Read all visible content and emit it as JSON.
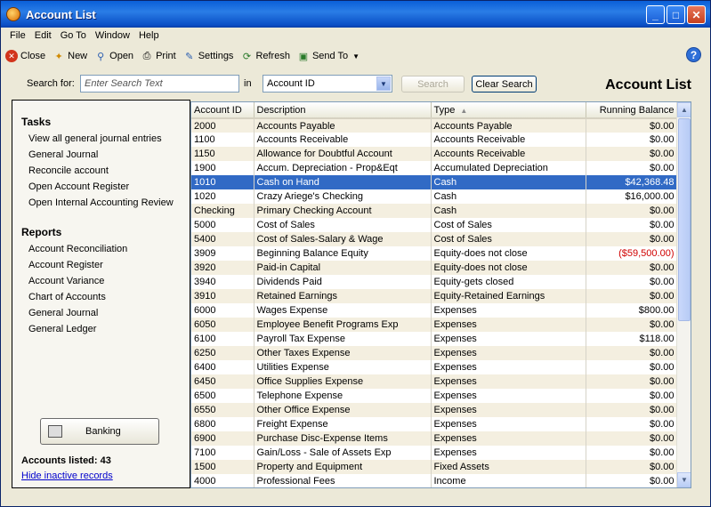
{
  "window": {
    "title": "Account List"
  },
  "menu": [
    "File",
    "Edit",
    "Go To",
    "Window",
    "Help"
  ],
  "toolbar": {
    "close": "Close",
    "new": "New",
    "open": "Open",
    "print": "Print",
    "settings": "Settings",
    "refresh": "Refresh",
    "send_to": "Send To"
  },
  "search": {
    "label": "Search for:",
    "placeholder": "Enter Search Text",
    "in_label": "in",
    "field": "Account ID",
    "search_btn": "Search",
    "clear_btn": "Clear Search"
  },
  "page_title": "Account List",
  "tasks": {
    "heading": "Tasks",
    "items": [
      "View all general journal entries",
      "General Journal",
      "Reconcile account",
      "Open Account Register",
      "Open Internal Accounting Review"
    ]
  },
  "reports": {
    "heading": "Reports",
    "items": [
      "Account Reconciliation",
      "Account Register",
      "Account Variance",
      "Chart of Accounts",
      "General Journal",
      "General Ledger"
    ]
  },
  "banking_label": "Banking",
  "accounts_listed": "Accounts listed: 43",
  "hide_inactive": "Hide inactive records",
  "columns": [
    "Account ID",
    "Description",
    "Type",
    "Running Balance"
  ],
  "rows": [
    [
      "2000",
      "Accounts Payable",
      "Accounts Payable",
      "$0.00"
    ],
    [
      "1100",
      "Accounts Receivable",
      "Accounts Receivable",
      "$0.00"
    ],
    [
      "1150",
      "Allowance for Doubtful Account",
      "Accounts Receivable",
      "$0.00"
    ],
    [
      "1900",
      "Accum. Depreciation - Prop&Eqt",
      "Accumulated Depreciation",
      "$0.00"
    ],
    [
      "1010",
      "Cash on Hand",
      "Cash",
      "$42,368.48"
    ],
    [
      "1020",
      "Crazy Ariege's Checking",
      "Cash",
      "$16,000.00"
    ],
    [
      "Checking",
      "Primary Checking Account",
      "Cash",
      "$0.00"
    ],
    [
      "5000",
      "Cost of Sales",
      "Cost of Sales",
      "$0.00"
    ],
    [
      "5400",
      "Cost of Sales-Salary & Wage",
      "Cost of Sales",
      "$0.00"
    ],
    [
      "3909",
      "Beginning Balance Equity",
      "Equity-does not close",
      "($59,500.00)"
    ],
    [
      "3920",
      "Paid-in Capital",
      "Equity-does not close",
      "$0.00"
    ],
    [
      "3940",
      "Dividends Paid",
      "Equity-gets closed",
      "$0.00"
    ],
    [
      "3910",
      "Retained Earnings",
      "Equity-Retained Earnings",
      "$0.00"
    ],
    [
      "6000",
      "Wages Expense",
      "Expenses",
      "$800.00"
    ],
    [
      "6050",
      "Employee Benefit Programs Exp",
      "Expenses",
      "$0.00"
    ],
    [
      "6100",
      "Payroll Tax Expense",
      "Expenses",
      "$118.00"
    ],
    [
      "6250",
      "Other Taxes Expense",
      "Expenses",
      "$0.00"
    ],
    [
      "6400",
      "Utilities Expense",
      "Expenses",
      "$0.00"
    ],
    [
      "6450",
      "Office Supplies Expense",
      "Expenses",
      "$0.00"
    ],
    [
      "6500",
      "Telephone Expense",
      "Expenses",
      "$0.00"
    ],
    [
      "6550",
      "Other Office Expense",
      "Expenses",
      "$0.00"
    ],
    [
      "6800",
      "Freight Expense",
      "Expenses",
      "$0.00"
    ],
    [
      "6900",
      "Purchase Disc-Expense Items",
      "Expenses",
      "$0.00"
    ],
    [
      "7100",
      "Gain/Loss - Sale of Assets Exp",
      "Expenses",
      "$0.00"
    ],
    [
      "1500",
      "Property and Equipment",
      "Fixed Assets",
      "$0.00"
    ],
    [
      "4000",
      "Professional Fees",
      "Income",
      "$0.00"
    ]
  ],
  "selected_row": "1010",
  "negative_color": "#d00000",
  "selection_color": "#316ac5"
}
